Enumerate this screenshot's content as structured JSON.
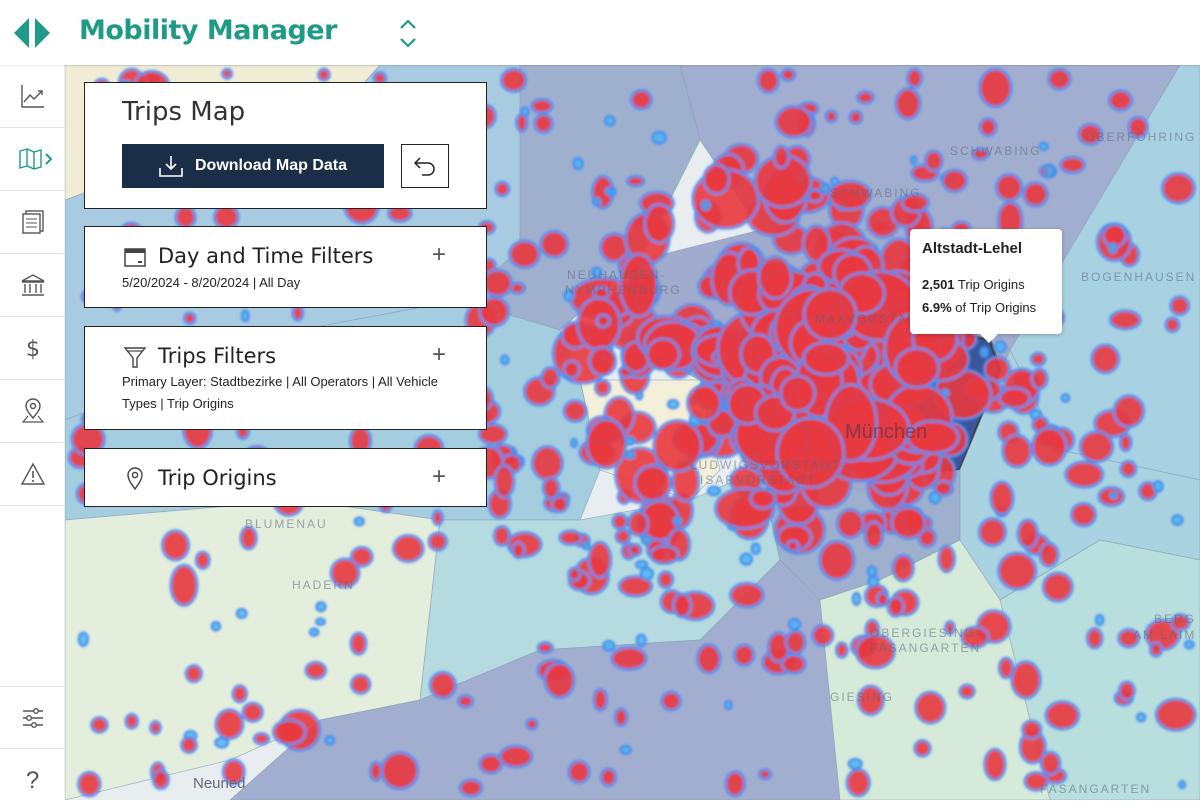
{
  "header": {
    "app_title": "Mobility Manager",
    "logo_icon": "diamond-logo-icon",
    "switcher_icon": "chevron-up-down-icon"
  },
  "colors": {
    "accent": "#1e9a86",
    "button_dark": "#1b2e47",
    "heat_high": "#e8383f",
    "heat_low": "#3aa8ff",
    "selected_district": "#3b5597"
  },
  "sidebar": {
    "items": [
      {
        "name": "analytics",
        "icon": "line-chart-icon"
      },
      {
        "name": "map",
        "icon": "map-icon",
        "active": true
      },
      {
        "name": "reports",
        "icon": "report-icon"
      },
      {
        "name": "policy",
        "icon": "bank-icon"
      },
      {
        "name": "billing",
        "icon": "dollar-icon"
      },
      {
        "name": "locations",
        "icon": "location-pin-icon"
      },
      {
        "name": "alerts",
        "icon": "warning-icon"
      }
    ],
    "bottom": [
      {
        "name": "settings",
        "icon": "sliders-icon"
      },
      {
        "name": "help",
        "label": "?",
        "icon": "question-icon"
      }
    ]
  },
  "trips_map": {
    "title": "Trips Map",
    "download_label": "Download Map Data",
    "undo_icon": "undo-icon"
  },
  "filters": [
    {
      "title": "Day and Time Filters",
      "summary": "5/20/2024 - 8/20/2024 | All Day",
      "icon": "calendar-icon",
      "expand": "+"
    },
    {
      "title": "Trips Filters",
      "summary": "Primary Layer: Stadtbezirke | All Operators | All Vehicle Types | Trip Origins",
      "icon": "filter-icon",
      "expand": "+"
    },
    {
      "title": "Trip Origins",
      "summary": "",
      "icon": "location-pin-icon",
      "expand": "+"
    }
  ],
  "tooltip": {
    "district": "Altstadt-Lehel",
    "count": "2,501",
    "count_label": " Trip Origins",
    "share": "6.9%",
    "share_label": " of Trip Origins"
  },
  "map_labels": [
    "SCHWABING",
    "SCHWABING",
    "OBERFÖHRING",
    "NEUHAUSEN-",
    "NYMPHENBURG",
    "MAXVORSTADT",
    "München",
    "LUDWIGSVORSTADT-",
    "ISARVORSTADT",
    "BOGENHAUSEN",
    "BLUMENAU",
    "HADERN",
    "OBERGIESING-",
    "FASANGARTEN",
    "GIESING",
    "FASANGARTEN",
    "Neuried",
    "BERG",
    "AM LAIM"
  ]
}
